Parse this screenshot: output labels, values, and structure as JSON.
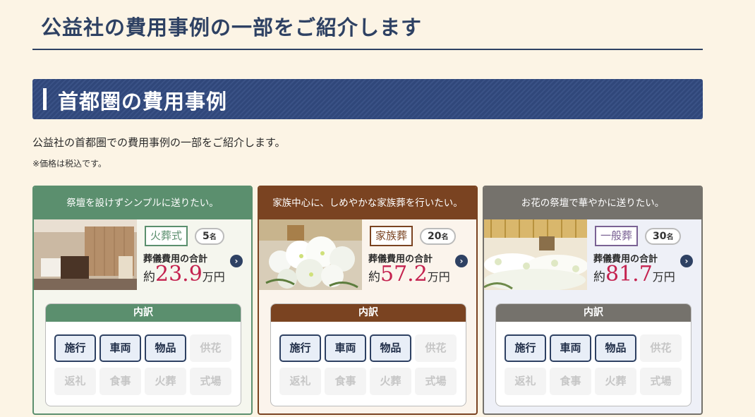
{
  "page": {
    "title": "公益社の費用事例の一部をご紹介します",
    "section_title": "首都圏の費用事例",
    "intro": "公益社の首都圏での費用事例の一部をご紹介します。",
    "note": "※価格は税込です。"
  },
  "cards": [
    {
      "headline": "祭壇を設けずシンプルに送りたい。",
      "type": "火葬式",
      "count": "5",
      "count_unit": "名",
      "total_label": "葬儀費用の合計",
      "price_prefix": "約",
      "price": "23.9",
      "price_unit": "万円",
      "breakdown_title": "内訳",
      "items": [
        {
          "label": "施行",
          "active": true
        },
        {
          "label": "車両",
          "active": true
        },
        {
          "label": "物品",
          "active": true
        },
        {
          "label": "供花",
          "active": false
        },
        {
          "label": "返礼",
          "active": false
        },
        {
          "label": "食事",
          "active": false
        },
        {
          "label": "火葬",
          "active": false
        },
        {
          "label": "式場",
          "active": false
        }
      ],
      "colors": {
        "accent": "#5b8f6e",
        "bg": "#f5f6ee"
      }
    },
    {
      "headline": "家族中心に、しめやかな家族葬を行いたい。",
      "type": "家族葬",
      "count": "20",
      "count_unit": "名",
      "total_label": "葬儀費用の合計",
      "price_prefix": "約",
      "price": "57.2",
      "price_unit": "万円",
      "breakdown_title": "内訳",
      "items": [
        {
          "label": "施行",
          "active": true
        },
        {
          "label": "車両",
          "active": true
        },
        {
          "label": "物品",
          "active": true
        },
        {
          "label": "供花",
          "active": false
        },
        {
          "label": "返礼",
          "active": false
        },
        {
          "label": "食事",
          "active": false
        },
        {
          "label": "火葬",
          "active": false
        },
        {
          "label": "式場",
          "active": false
        }
      ],
      "colors": {
        "accent": "#7a4321",
        "bg": "#fbf4ec"
      }
    },
    {
      "headline": "お花の祭壇で華やかに送りたい。",
      "type": "一般葬",
      "count": "30",
      "count_unit": "名",
      "total_label": "葬儀費用の合計",
      "price_prefix": "約",
      "price": "81.7",
      "price_unit": "万円",
      "breakdown_title": "内訳",
      "items": [
        {
          "label": "施行",
          "active": true
        },
        {
          "label": "車両",
          "active": true
        },
        {
          "label": "物品",
          "active": true
        },
        {
          "label": "供花",
          "active": false
        },
        {
          "label": "返礼",
          "active": false
        },
        {
          "label": "食事",
          "active": false
        },
        {
          "label": "火葬",
          "active": false
        },
        {
          "label": "式場",
          "active": false
        }
      ],
      "colors": {
        "accent": "#75726c",
        "bg": "#eef0f7",
        "tag": "#7a6294"
      }
    }
  ]
}
